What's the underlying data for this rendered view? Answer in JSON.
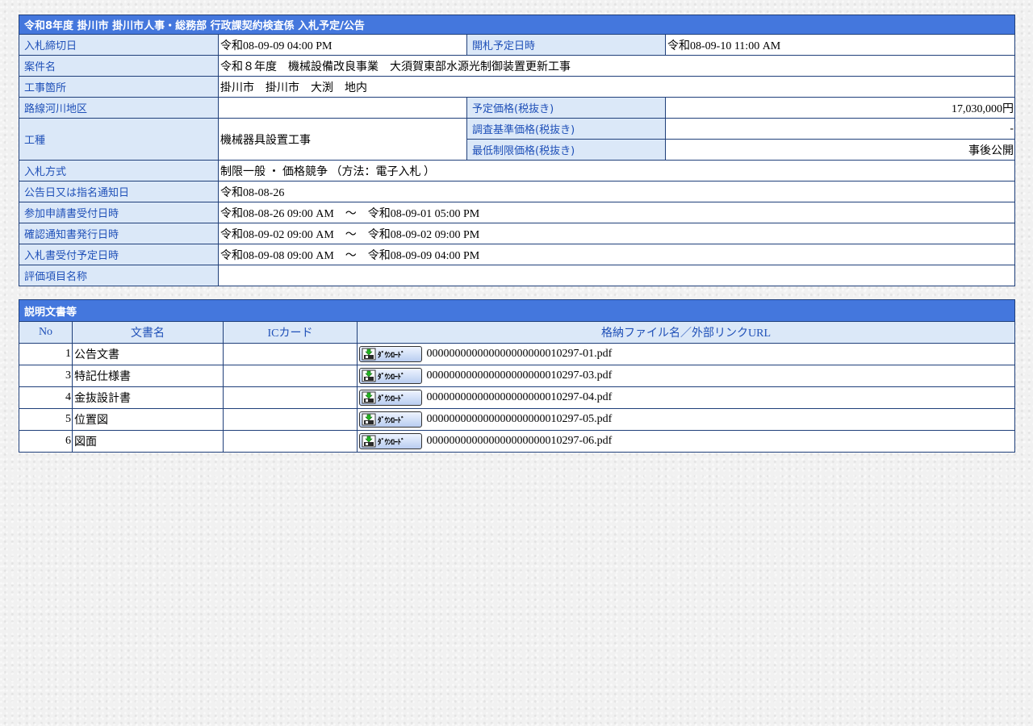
{
  "notice": {
    "title": "令和8年度 掛川市 掛川市人事・総務部 行政課契約検査係 入札予定/公告",
    "rows": {
      "deadline_label": "入札締切日",
      "deadline_value": "令和08-09-09 04:00 PM",
      "opening_label": "開札予定日時",
      "opening_value": "令和08-09-10 11:00 AM",
      "name_label": "案件名",
      "name_value": "令和８年度　機械設備改良事業　大須賀東部水源光制御装置更新工事",
      "place_label": "工事箇所",
      "place_value": "掛川市　掛川市　大渕　地内",
      "route_label": "路線河川地区",
      "route_value": "",
      "planned_price_label": "予定価格(税抜き)",
      "planned_price_value": "17,030,000円",
      "type_label": "工種",
      "type_value": "機械器具設置工事",
      "survey_price_label": "調査基準価格(税抜き)",
      "survey_price_value": "-",
      "min_price_label": "最低制限価格(税抜き)",
      "min_price_value": "事後公開",
      "method_label": "入札方式",
      "method_value": "制限一般 ・ 価格競争 （方法：電子入札 ）",
      "announce_label": "公告日又は指名通知日",
      "announce_value": "令和08-08-26",
      "apply_label": "参加申請書受付日時",
      "apply_value": "令和08-08-26 09:00 AM　～　令和08-09-01 05:00 PM",
      "confirm_label": "確認通知書発行日時",
      "confirm_value": "令和08-09-02 09:00 AM　～　令和08-09-02 09:00 PM",
      "receipt_label": "入札書受付予定日時",
      "receipt_value": "令和08-09-08 09:00 AM　～　令和08-09-09 04:00 PM",
      "eval_label": "評価項目名称",
      "eval_value": ""
    }
  },
  "documents": {
    "title": "説明文書等",
    "headers": {
      "no": "No",
      "name": "文書名",
      "ic": "ICカード",
      "file": "格納ファイル名／外部リンクURL"
    },
    "download_label": "ﾀﾞｳﾝﾛｰﾄﾞ",
    "items": [
      {
        "no": "1",
        "name": "公告文書",
        "ic": "",
        "file": "000000000000000000000010297-01.pdf"
      },
      {
        "no": "3",
        "name": "特記仕様書",
        "ic": "",
        "file": "000000000000000000000010297-03.pdf"
      },
      {
        "no": "4",
        "name": "金抜設計書",
        "ic": "",
        "file": "000000000000000000000010297-04.pdf"
      },
      {
        "no": "5",
        "name": "位置図",
        "ic": "",
        "file": "000000000000000000000010297-05.pdf"
      },
      {
        "no": "6",
        "name": "図面",
        "ic": "",
        "file": "000000000000000000000010297-06.pdf"
      }
    ]
  },
  "colors": {
    "header_bg": "#4477dd",
    "label_bg": "#dbe8f8",
    "label_text": "#1f50b8",
    "border": "#1f3f7a"
  }
}
